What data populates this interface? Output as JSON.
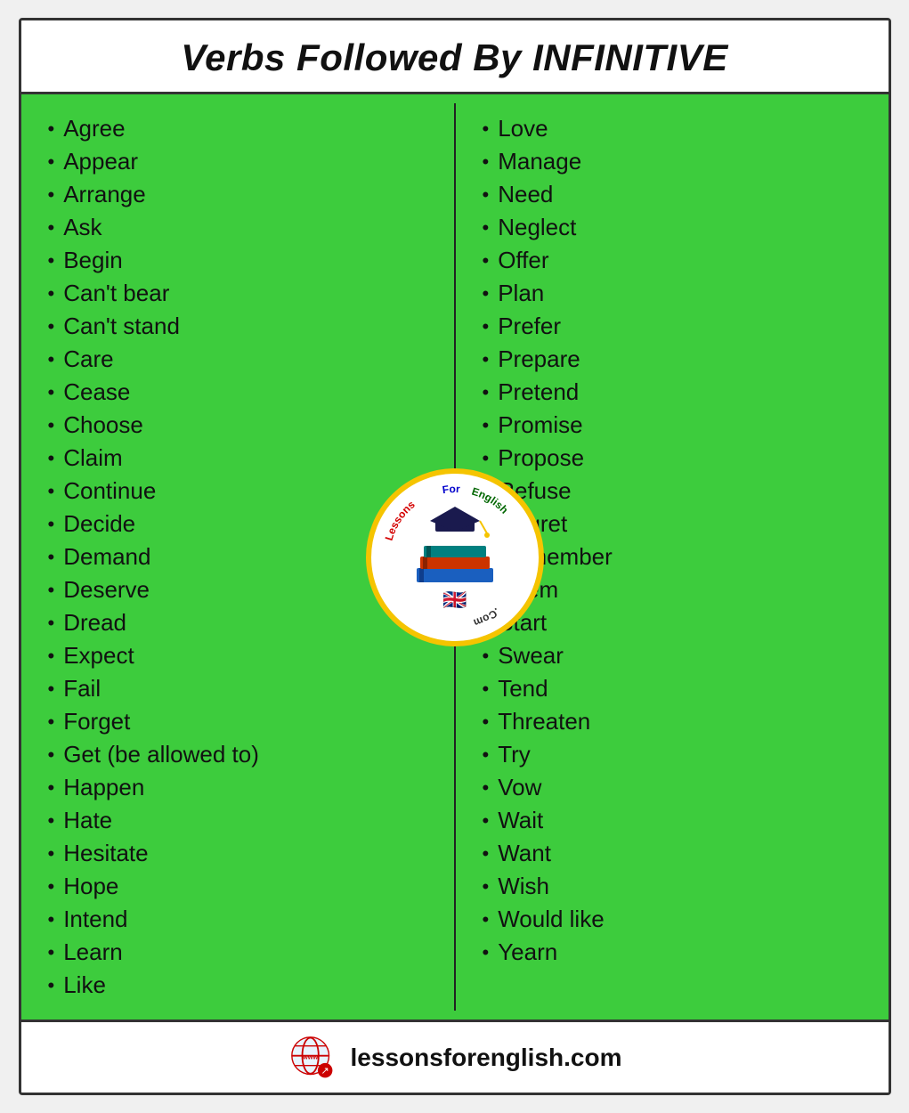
{
  "header": {
    "title_normal": "Verbs Followed By ",
    "title_bold": "INFINITIVE"
  },
  "left_column": {
    "items": [
      "Agree",
      "Appear",
      "Arrange",
      "Ask",
      "Begin",
      "Can't bear",
      "Can't stand",
      "Care",
      "Cease",
      "Choose",
      "Claim",
      "Continue",
      "Decide",
      "Demand",
      "Deserve",
      "Dread",
      "Expect",
      "Fail",
      "Forget",
      "Get (be allowed to)",
      "Happen",
      "Hate",
      "Hesitate",
      "Hope",
      "Intend",
      "Learn",
      "Like"
    ]
  },
  "right_column": {
    "items": [
      "Love",
      "Manage",
      "Need",
      "Neglect",
      "Offer",
      "Plan",
      "Prefer",
      "Prepare",
      "Pretend",
      "Promise",
      "Propose",
      "Refuse",
      "Regret",
      "Remember",
      "Seem",
      "Start",
      "Swear",
      "Tend",
      "Threaten",
      "Try",
      "Vow",
      "Wait",
      "Want",
      "Wish",
      "Would like",
      "Yearn"
    ]
  },
  "logo": {
    "arc_text": "LessonsForEnglish.Com",
    "url": "lessonsforenglish.com"
  },
  "footer": {
    "url": "lessonsforenglish.com"
  }
}
